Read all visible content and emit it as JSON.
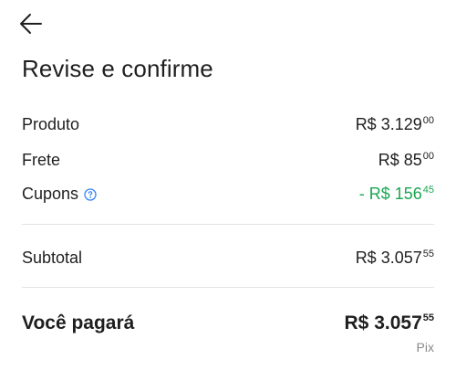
{
  "header": {
    "title": "Revise e confirme",
    "back_icon": "arrow-left-icon"
  },
  "summary": {
    "produto": {
      "label": "Produto",
      "main": "R$ 3.129",
      "cents": "00"
    },
    "frete": {
      "label": "Frete",
      "main": "R$ 85",
      "cents": "00"
    },
    "cupons": {
      "label": "Cupons",
      "main": "- R$ 156",
      "cents": "45",
      "help_icon": "question-circle-icon"
    },
    "subtotal": {
      "label": "Subtotal",
      "main": "R$ 3.057",
      "cents": "55"
    }
  },
  "total": {
    "label": "Você pagará",
    "main": "R$ 3.057",
    "cents": "55",
    "method": "Pix"
  },
  "colors": {
    "discount": "#1aa653",
    "help_icon": "#3483fa",
    "divider": "#e3e3e3",
    "muted": "#8a8a8a"
  }
}
